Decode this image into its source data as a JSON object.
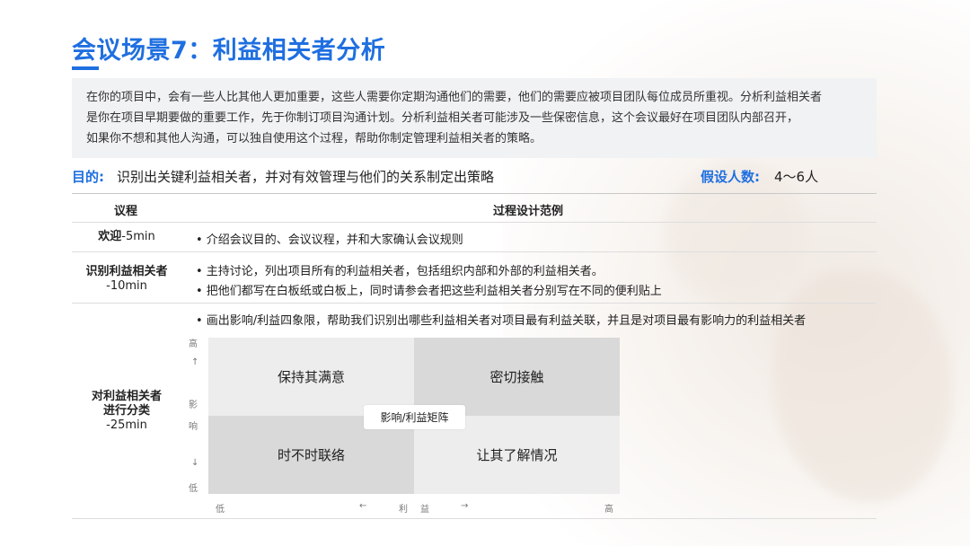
{
  "title": "会议场景7：利益相关者分析",
  "intro": {
    "lines": [
      "在你的项目中，会有一些人比其他人更加重要，这些人需要你定期沟通他们的需要，他们的需要应被项目团队每位成员所重视。分析利益相关者",
      "是你在项目早期要做的重要工作，先于你制订项目沟通计划。分析利益相关者可能涉及一些保密信息，这个会议最好在项目团队内部召开，",
      "如果你不想和其他人沟通，可以独自使用这个过程，帮助你制定管理利益相关者的策略。"
    ]
  },
  "purpose": {
    "label": "目的:",
    "text": "识别出关键利益相关者，并对有效管理与他们的关系制定出策略"
  },
  "people": {
    "label": "假设人数:",
    "value": "4～6人"
  },
  "table": {
    "col_agenda": "议程",
    "col_design": "过程设计范例",
    "rows": [
      {
        "agenda_bold": "欢迎",
        "agenda_rest": "-5min",
        "bullets": [
          "• 介绍会议目的、会议议程，并和大家确认会议规则"
        ]
      },
      {
        "agenda_bold": "识别利益相关者",
        "agenda_rest": "-10min",
        "bullets": [
          "• 主持讨论，列出项目所有的利益相关者，包括组织内部和外部的利益相关者。",
          "• 把他们都写在白板纸或白板上，同时请参会者把这些利益相关者分别写在不同的便利贴上"
        ]
      },
      {
        "agenda_bold_1": "对利益相关者",
        "agenda_bold_2": "进行分类",
        "agenda_rest": "-25min",
        "bullets": [
          "• 画出影响/利益四象限，帮助我们识别出哪些利益相关者对项目最有利益关联，并且是对项目最有影响力的利益相关者"
        ]
      }
    ]
  },
  "matrix": {
    "title": "影响/利益矩阵",
    "quadrants": {
      "top_left": "保持其满意",
      "top_right": "密切接触",
      "bottom_left": "时不时联络",
      "bottom_right": "让其了解情况"
    },
    "y_axis": {
      "high": "高",
      "up_arrow": "↑",
      "label_1": "影",
      "label_2": "响",
      "down_arrow": "↓",
      "low": "低"
    },
    "x_axis": {
      "low": "低",
      "left_arrow": "←",
      "label_1": "利",
      "label_2": "益",
      "right_arrow": "→",
      "high": "高"
    },
    "colors": {
      "dark_quadrant": "#d9d9d9",
      "light_quadrant": "#ededed"
    }
  },
  "colors": {
    "accent": "#1f6fe0",
    "intro_bg": "#f1f2f4"
  }
}
